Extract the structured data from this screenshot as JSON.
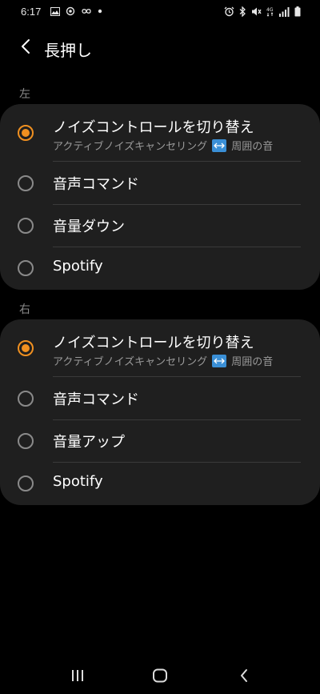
{
  "status_bar": {
    "time": "6:17",
    "left_icons": [
      "gallery-icon",
      "sync-icon",
      "infinity-icon",
      "dot-icon"
    ],
    "right_icons": [
      "alarm-icon",
      "bluetooth-icon",
      "mute-icon",
      "4g-icon",
      "signal-icon",
      "battery-icon"
    ]
  },
  "header": {
    "title": "長押し",
    "back_icon": "chevron-left-icon"
  },
  "sections": [
    {
      "label": "左",
      "options": [
        {
          "title": "ノイズコントロールを切り替え",
          "subtitle_left": "アクティブノイズキャンセリング",
          "subtitle_icon": "swap-arrows-icon",
          "subtitle_right": "周囲の音",
          "selected": true
        },
        {
          "title": "音声コマンド",
          "selected": false
        },
        {
          "title": "音量ダウン",
          "selected": false
        },
        {
          "title": "Spotify",
          "selected": false
        }
      ]
    },
    {
      "label": "右",
      "options": [
        {
          "title": "ノイズコントロールを切り替え",
          "subtitle_left": "アクティブノイズキャンセリング",
          "subtitle_icon": "swap-arrows-icon",
          "subtitle_right": "周囲の音",
          "selected": true
        },
        {
          "title": "音声コマンド",
          "selected": false
        },
        {
          "title": "音量アップ",
          "selected": false
        },
        {
          "title": "Spotify",
          "selected": false
        }
      ]
    }
  ],
  "nav_bar": {
    "buttons": [
      "recent-apps-icon",
      "home-icon",
      "back-icon"
    ]
  },
  "colors": {
    "background": "#000000",
    "card": "#1f1f1f",
    "accent": "#f09020",
    "secondary_text": "#9a9a9a",
    "swap_icon": "#3a8fd6"
  }
}
